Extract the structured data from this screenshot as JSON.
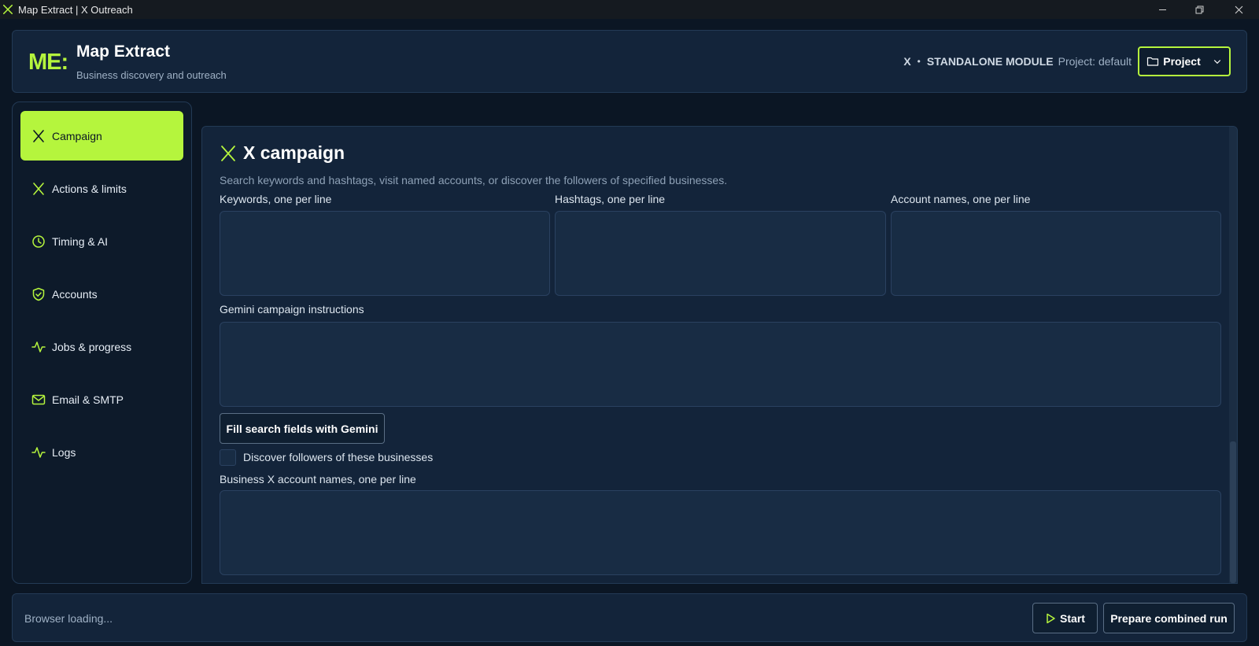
{
  "window": {
    "title": "Map Extract | X Outreach",
    "app_icon": "x-logo-icon",
    "controls": [
      "minimize-icon",
      "restore-icon",
      "close-icon"
    ]
  },
  "header": {
    "logo": "ME:",
    "title": "Map Extract",
    "subtitle": "Business discovery and outreach",
    "module_platform": "X",
    "module_separator": "•",
    "module_label": "STANDALONE MODULE",
    "project_label": "Project: default",
    "project_button": "Project",
    "project_icon": "folder-icon",
    "project_chevron": "chevron-down-icon"
  },
  "sidebar": {
    "items": [
      {
        "label": "Campaign",
        "icon": "x-logo-icon",
        "active": true
      },
      {
        "label": "Actions & limits",
        "icon": "x-logo-icon",
        "active": false
      },
      {
        "label": "Timing & AI",
        "icon": "clock-icon",
        "active": false
      },
      {
        "label": "Accounts",
        "icon": "shield-check-icon",
        "active": false
      },
      {
        "label": "Jobs & progress",
        "icon": "activity-icon",
        "active": false
      },
      {
        "label": "Email & SMTP",
        "icon": "mail-icon",
        "active": false
      },
      {
        "label": "Logs",
        "icon": "activity-icon",
        "active": false
      }
    ]
  },
  "main": {
    "title": "X campaign",
    "title_icon": "x-logo-icon",
    "description": "Search keywords and hashtags, visit named accounts, or discover the followers of specified businesses.",
    "keywords_label": "Keywords, one per line",
    "keywords_value": "",
    "hashtags_label": "Hashtags, one per line",
    "hashtags_value": "",
    "accounts_label": "Account names, one per line",
    "accounts_value": "",
    "gemini_label": "Gemini campaign instructions",
    "gemini_value": "",
    "gemini_button": "Fill search fields with Gemini",
    "discover_checkbox_label": "Discover followers of these businesses",
    "discover_checked": false,
    "business_label": "Business X account names, one per line",
    "business_value": ""
  },
  "footer": {
    "status": "Browser loading...",
    "start_button": "Start",
    "start_icon": "play-icon",
    "combined_button": "Prepare combined run"
  },
  "colors": {
    "accent": "#b5f53d",
    "background": "#0b1624",
    "panel": "#13243a",
    "input": "#182c44"
  }
}
